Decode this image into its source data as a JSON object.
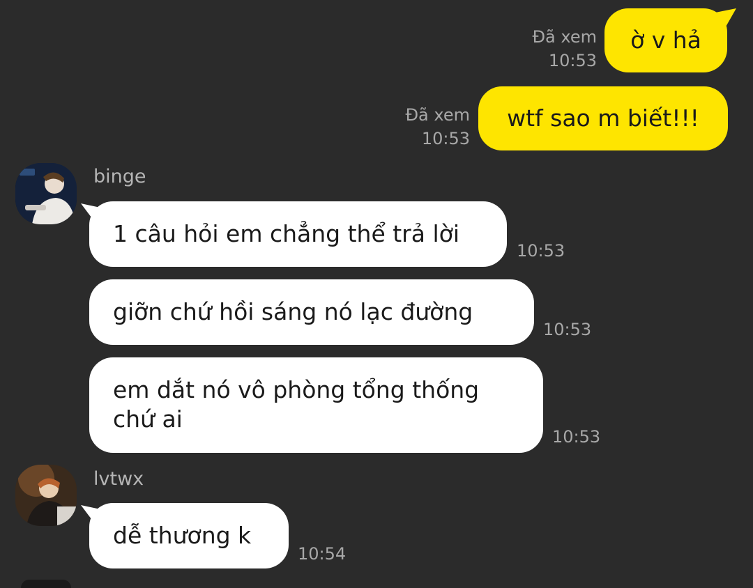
{
  "outgoing": [
    {
      "text": "ờ v hả",
      "status": "Đã xem",
      "time": "10:53"
    },
    {
      "text": "wtf sao m biết!!!",
      "status": "Đã xem",
      "time": "10:53"
    }
  ],
  "incoming": [
    {
      "sender": "binge",
      "messages": [
        {
          "text": "1 câu hỏi em chẳng thể trả lời",
          "time": "10:53"
        },
        {
          "text": "giỡn chứ hồi sáng nó lạc đường",
          "time": "10:53"
        },
        {
          "line1": "em dắt nó vô phòng tổng thống",
          "line2": "chứ ai",
          "time": "10:53"
        }
      ]
    },
    {
      "sender": "lvtwx",
      "messages": [
        {
          "text": "dễ thương k",
          "time": "10:54"
        }
      ]
    }
  ],
  "colors": {
    "background": "#2b2b2b",
    "outgoing_bubble": "#fee500",
    "incoming_bubble": "#ffffff",
    "meta_text": "#a8a8a8"
  }
}
